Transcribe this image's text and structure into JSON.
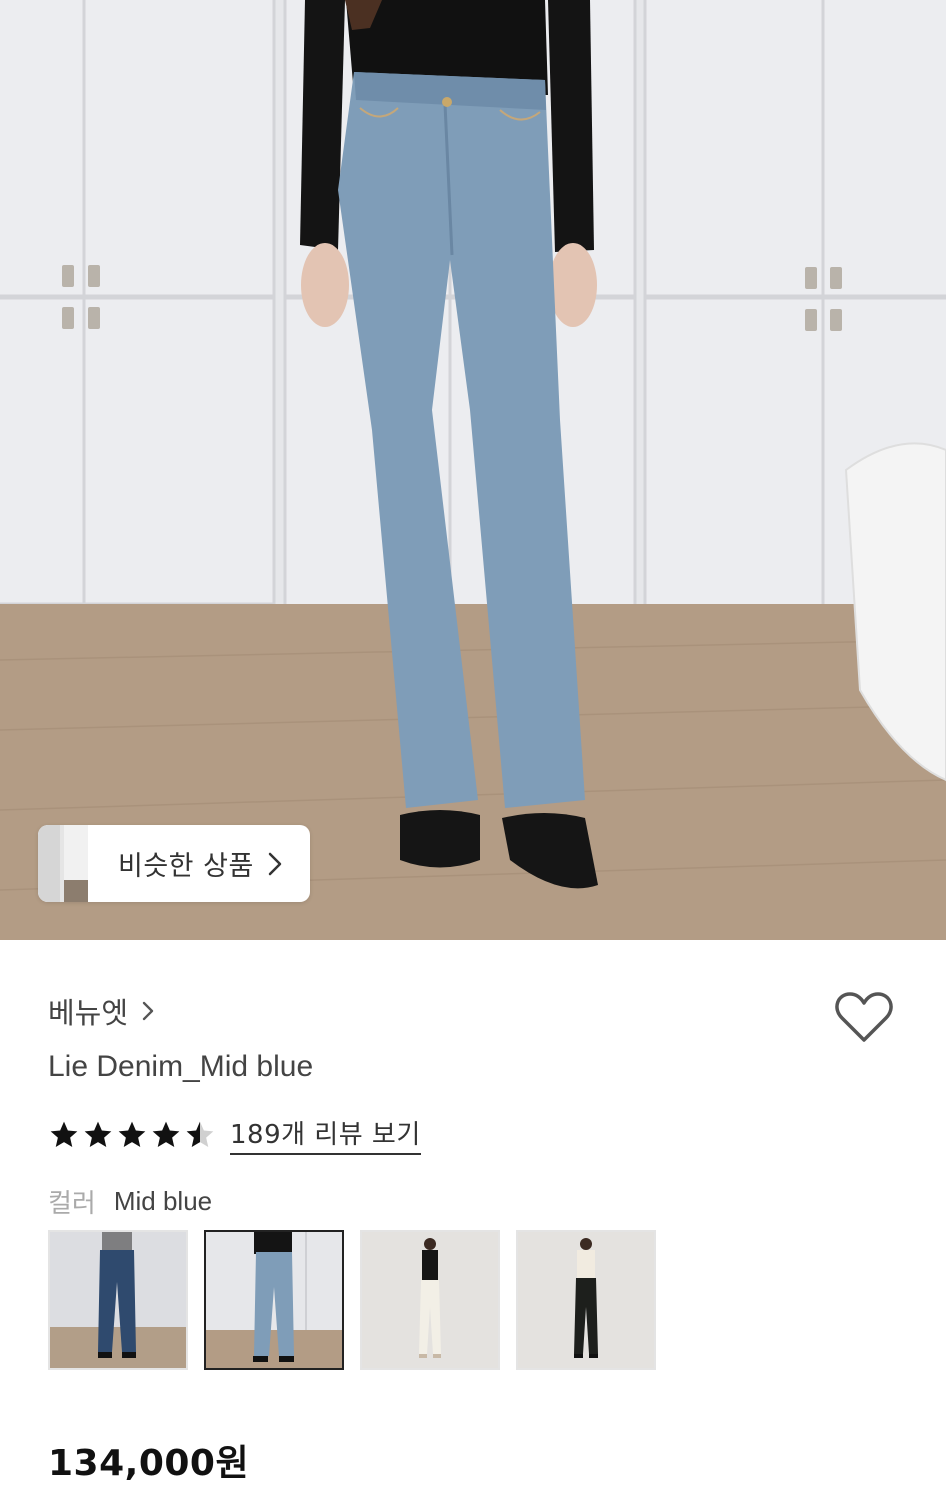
{
  "hero": {
    "similar_button_label": "비슷한 상품"
  },
  "product": {
    "brand": "베뉴엣",
    "title": "Lie Denim_Mid blue",
    "rating": 4.5,
    "rating_max": 5,
    "review_link": "189개 리뷰 보기",
    "color_label": "컬러",
    "color_value": "Mid blue",
    "price": "134,000원"
  },
  "colors": {
    "accent": "#222222",
    "muted_label": "#aaaaaa",
    "denim": "#7f9db8",
    "floor": "#b39c85"
  },
  "swatches": [
    {
      "name": "dark-denim",
      "selected": false
    },
    {
      "name": "mid-blue",
      "selected": true
    },
    {
      "name": "ivory",
      "selected": false
    },
    {
      "name": "black",
      "selected": false
    }
  ]
}
